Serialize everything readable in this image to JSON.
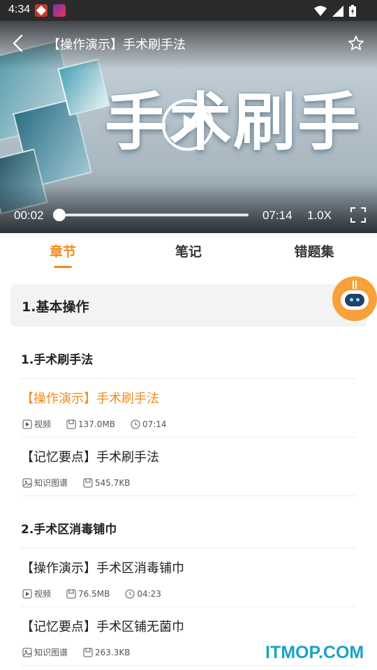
{
  "status_bar": {
    "time": "4:34"
  },
  "video": {
    "title": "【操作演示】手术刷手法",
    "overlay_text": "手术刷手",
    "current_time": "00:02",
    "total_time": "07:14",
    "speed": "1.0X",
    "progress_fraction": 0.005
  },
  "tabs": [
    {
      "label": "章节"
    },
    {
      "label": "笔记"
    },
    {
      "label": "错题集"
    }
  ],
  "section": {
    "title": "1.基本操作"
  },
  "chapters": [
    {
      "title": "1.手术刷手法",
      "items": [
        {
          "title": "【操作演示】手术刷手法",
          "type": "视频",
          "size": "137.0MB",
          "duration": "07:14"
        },
        {
          "title": "【记忆要点】手术刷手法",
          "type": "知识图谱",
          "size": "545.7KB"
        }
      ]
    },
    {
      "title": "2.手术区消毒铺巾",
      "items": [
        {
          "title": "【操作演示】手术区消毒铺巾",
          "type": "视频",
          "size": "76.5MB",
          "duration": "04:23"
        },
        {
          "title": "【记忆要点】手术区铺无菌巾",
          "type": "知识图谱",
          "size": "263.3KB"
        }
      ]
    }
  ],
  "watermark": "ITMOP.COM",
  "colors": {
    "accent": "#f08c1c",
    "watermark": "#1ba2c8"
  }
}
